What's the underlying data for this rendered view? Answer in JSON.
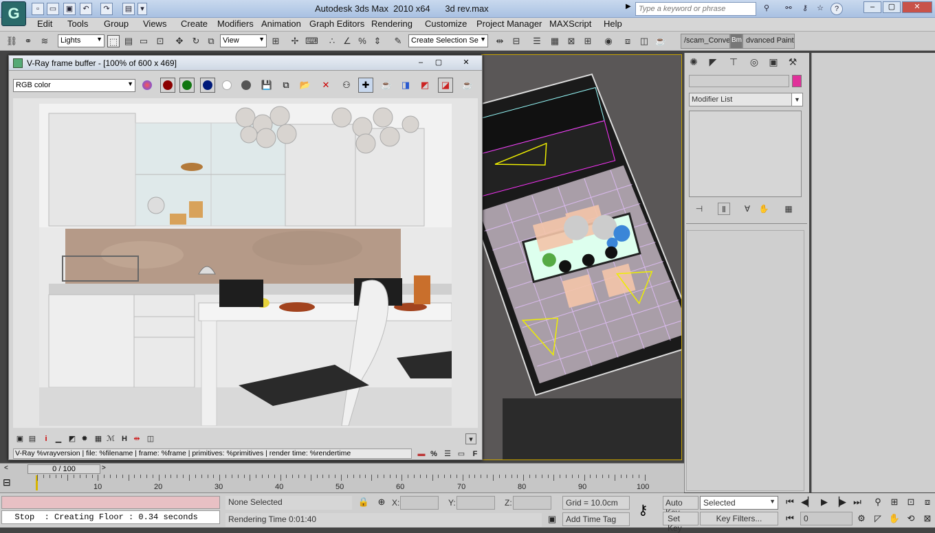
{
  "titlebar": {
    "title": "Autodesk 3ds Max  2010 x64      3d rev.max",
    "search_placeholder": "Type a keyword or phrase"
  },
  "menu": [
    "Edit",
    "Tools",
    "Group",
    "Views",
    "Create",
    "Modifiers",
    "Animation",
    "Graph Editors",
    "Rendering",
    "Customize",
    "Project Manager",
    "MAXScript",
    "Help"
  ],
  "toolbar": {
    "filter": "Lights",
    "reference_coord": "View",
    "selection_set": "Create Selection Se",
    "tab_left": "/scam_Conver",
    "tab_bm": "Bm",
    "tab_right": "dvanced Paint"
  },
  "vfb": {
    "title": "V-Ray frame buffer - [100% of 600 x 469]",
    "channel": "RGB color",
    "status": "V-Ray %vrayversion | file: %filename | frame: %frame | primitives: %primitives | render time: %rendertime",
    "bottom_percent": "%",
    "bottom_f": "F"
  },
  "command_panel": {
    "modifier_list": "Modifier List"
  },
  "timeline": {
    "thumb": "0 / 100",
    "ticks": [
      "10",
      "20",
      "30",
      "40",
      "50",
      "60",
      "70",
      "80",
      "90",
      "100"
    ]
  },
  "statusbar": {
    "maxscript_output": "  Stop  : Creating Floor : 0.34 seconds",
    "selection": "None Selected",
    "render_time": "Rendering Time  0:01:40",
    "x_label": "X:",
    "y_label": "Y:",
    "z_label": "Z:",
    "grid": "Grid = 10.0cm",
    "add_time_tag": "Add Time Tag",
    "auto_key": "Auto Key",
    "set_key": "Set Key",
    "key_mode": "Selected",
    "key_filters": "Key Filters...",
    "frame": "0"
  },
  "colors": {
    "viewport_border": "#c9a400",
    "swatch": "#e0309a",
    "maxscript_pink": "#e8c0c4"
  }
}
